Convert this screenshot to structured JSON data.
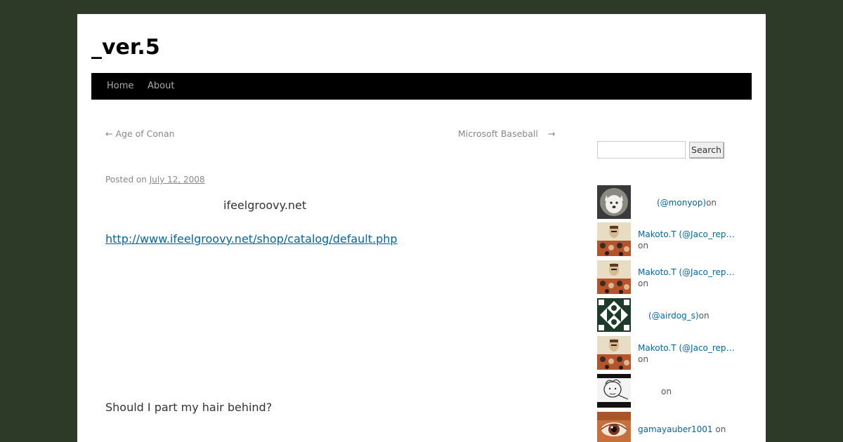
{
  "site": {
    "title": "_ver.5"
  },
  "nav": {
    "items": [
      {
        "label": "Home"
      },
      {
        "label": "About"
      }
    ]
  },
  "post_nav": {
    "prev": "Age of Conan",
    "prev_arrow": "←",
    "next": "Microsoft Baseball",
    "next_arrow": "→"
  },
  "post": {
    "posted_on": "Posted on",
    "date": "July 12, 2008",
    "name": "ifeelgroovy.net",
    "link": "http://www.ifeelgroovy.net/shop/catalog/default.php",
    "question": "Should I part my hair behind?"
  },
  "sidebar": {
    "search": {
      "button_label": "Search",
      "placeholder": ""
    },
    "recent_comments": [
      {
        "author": "(@monyop)",
        "on": "on",
        "avatar": "white-dog-avatar"
      },
      {
        "author": "Makoto.T (@Jaco_repo…",
        "on": "on",
        "avatar": "collage-avatar"
      },
      {
        "author": "Makoto.T (@Jaco_repo…",
        "on": "on",
        "avatar": "collage-avatar"
      },
      {
        "author": "(@airdog_s)",
        "on": "on",
        "avatar": "pattern-avatar"
      },
      {
        "author": "Makoto.T (@Jaco_repo…",
        "on": "on",
        "avatar": "collage-avatar"
      },
      {
        "author": "",
        "on": "on",
        "avatar": "sketch-avatar"
      },
      {
        "author": "gamayauber1001",
        "on": "on",
        "avatar": "eye-avatar"
      }
    ]
  },
  "colors": {
    "background": "#2e3a28",
    "nav_bar": "#000000",
    "link": "#0066aa"
  }
}
